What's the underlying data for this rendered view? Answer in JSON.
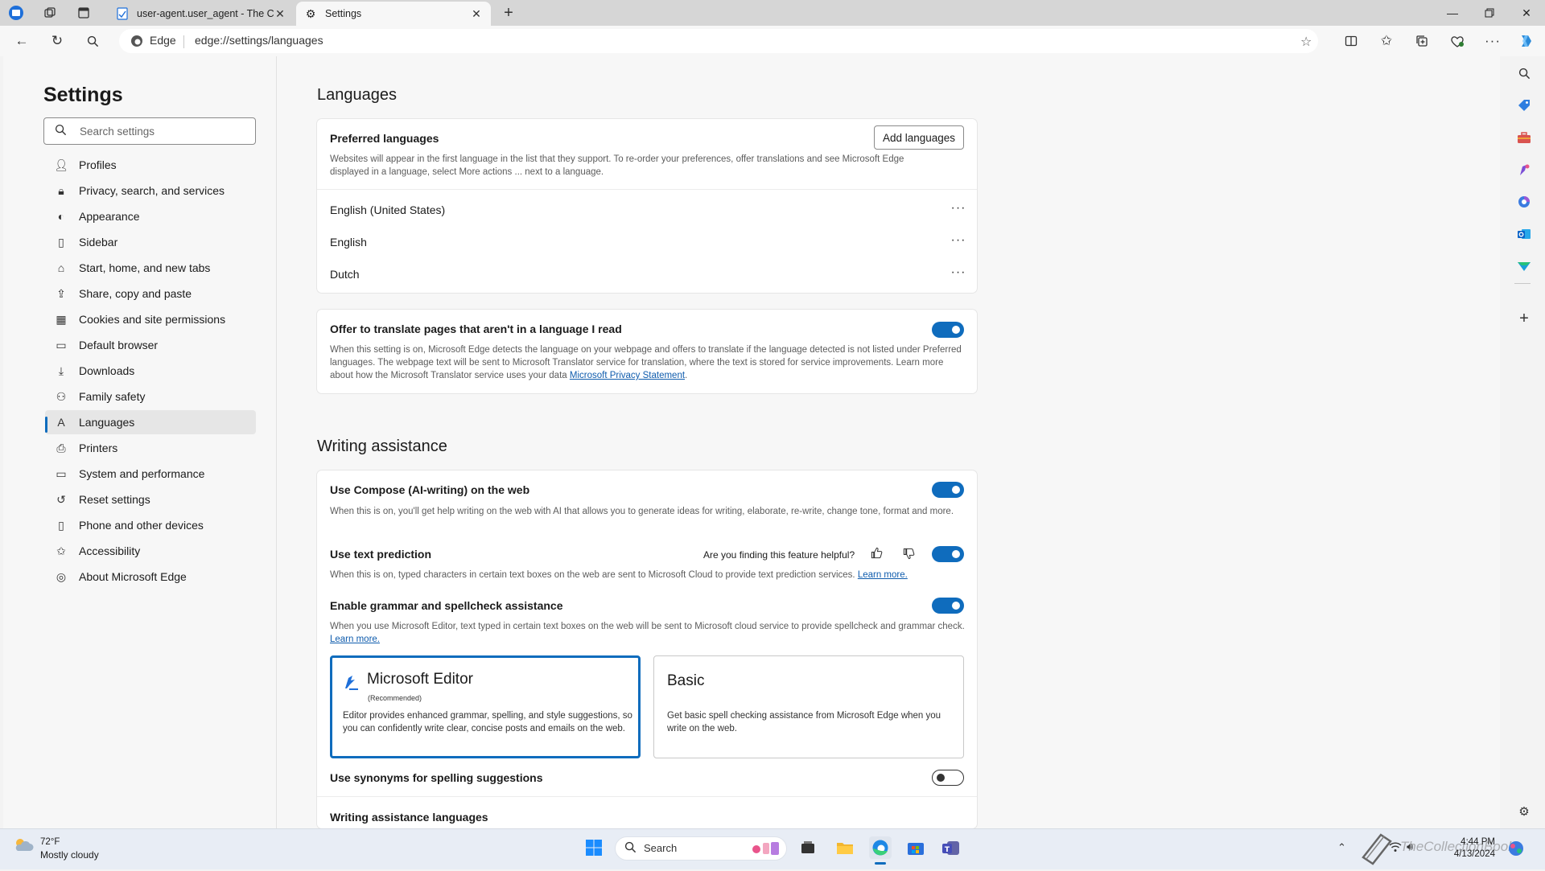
{
  "browser": {
    "tabs": [
      {
        "title": "user-agent.user_agent - The Coll",
        "active": false
      },
      {
        "title": "Settings",
        "active": true
      }
    ],
    "address": {
      "identity_label": "Edge",
      "url": "edge://settings/languages"
    }
  },
  "sidebar": {
    "title": "Settings",
    "search_placeholder": "Search settings",
    "items": [
      {
        "label": "Profiles",
        "icon": "person-icon"
      },
      {
        "label": "Privacy, search, and services",
        "icon": "lock-icon"
      },
      {
        "label": "Appearance",
        "icon": "appearance-icon"
      },
      {
        "label": "Sidebar",
        "icon": "sidebar-icon"
      },
      {
        "label": "Start, home, and new tabs",
        "icon": "home-icon"
      },
      {
        "label": "Share, copy and paste",
        "icon": "share-icon"
      },
      {
        "label": "Cookies and site permissions",
        "icon": "cookie-icon"
      },
      {
        "label": "Default browser",
        "icon": "browser-icon"
      },
      {
        "label": "Downloads",
        "icon": "download-icon"
      },
      {
        "label": "Family safety",
        "icon": "family-icon"
      },
      {
        "label": "Languages",
        "icon": "languages-icon",
        "selected": true
      },
      {
        "label": "Printers",
        "icon": "printer-icon"
      },
      {
        "label": "System and performance",
        "icon": "system-icon"
      },
      {
        "label": "Reset settings",
        "icon": "reset-icon"
      },
      {
        "label": "Phone and other devices",
        "icon": "phone-icon"
      },
      {
        "label": "Accessibility",
        "icon": "accessibility-icon"
      },
      {
        "label": "About Microsoft Edge",
        "icon": "edge-icon"
      }
    ]
  },
  "languages": {
    "heading": "Languages",
    "preferred_label": "Preferred languages",
    "add_button": "Add languages",
    "preferred_desc": "Websites will appear in the first language in the list that they support. To re-order your preferences, offer translations and see Microsoft Edge displayed in a language, select More actions ... next to a language.",
    "list": [
      "English (United States)",
      "English",
      "Dutch"
    ],
    "more_actions": "···",
    "translate_label": "Offer to translate pages that aren't in a language I read",
    "translate_on": true,
    "translate_desc": "When this setting is on, Microsoft Edge detects the language on your webpage and offers to translate if the language detected is not listed under Preferred languages. The webpage text will be sent to Microsoft Translator service for translation, where the text is stored for service improvements. Learn more about how the Microsoft Translator service uses your data ",
    "translate_link": "Microsoft Privacy Statement",
    "translate_tail": "."
  },
  "writing": {
    "heading": "Writing assistance",
    "compose_label": "Use Compose (AI-writing) on the web",
    "compose_on": true,
    "compose_desc": "When this is on, you'll get help writing on the web with AI that allows you to generate ideas for writing, elaborate, re-write, change tone, format and more.",
    "prediction_label": "Use text prediction",
    "feedback_question": "Are you finding this feature helpful?",
    "prediction_on": true,
    "prediction_desc": "When this is on, typed characters in certain text boxes on the web are sent to Microsoft Cloud to provide text prediction services. ",
    "learn_more": "Learn more.",
    "grammar_label": "Enable grammar and spellcheck assistance",
    "grammar_on": true,
    "grammar_desc": "When you use Microsoft Editor, text typed in certain text boxes on the web will be sent to Microsoft cloud service to provide spellcheck and grammar check. ",
    "editor_title": "Microsoft Editor",
    "editor_recommended": "(Recommended)",
    "editor_desc": "Editor provides enhanced grammar, spelling, and style suggestions, so you can confidently write clear, concise posts and emails on the web.",
    "basic_title": "Basic",
    "basic_desc": "Get basic spell checking assistance from Microsoft Edge when you write on the web.",
    "synonyms_label": "Use synonyms for spelling suggestions",
    "synonyms_on": false,
    "languages_label": "Writing assistance languages"
  },
  "taskbar": {
    "weather_temp": "72°F",
    "weather_condition": "Mostly cloudy",
    "search_label": "Search",
    "time": "4:44 PM",
    "date": "4/13/2024",
    "watermark": "TheCollectionBook"
  },
  "colors": {
    "accent": "#0f6cbd",
    "link": "#0f5cad"
  }
}
